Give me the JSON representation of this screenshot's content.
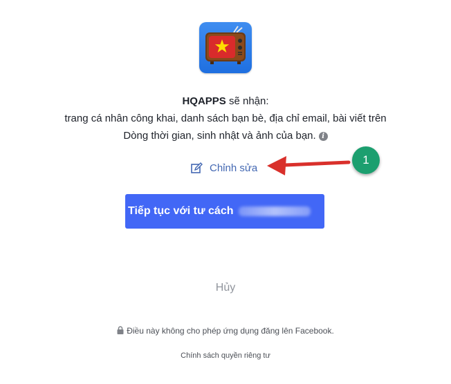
{
  "app_icon": {
    "name": "tv-vietnam-flag-icon"
  },
  "permission": {
    "app_name": "HQAPPS",
    "receives": " sẽ nhận:",
    "line2": "trang cá nhân công khai, danh sách bạn bè, địa chỉ email, bài viết trên",
    "line3": "Dòng thời gian, sinh nhật và ảnh của bạn."
  },
  "edit": {
    "label": "Chỉnh sửa"
  },
  "annotation": {
    "step": "1",
    "arrow_color": "#e0322d"
  },
  "continue_button": {
    "label": "Tiếp tục với tư cách"
  },
  "cancel": {
    "label": "Hủy"
  },
  "note": {
    "text": "Điều này không cho phép ứng dụng đăng lên Facebook."
  },
  "privacy": {
    "label": "Chính sách quyền riêng tư"
  },
  "colors": {
    "accent": "#4267f6",
    "link": "#4267b2",
    "badge": "#1c9f6f"
  }
}
